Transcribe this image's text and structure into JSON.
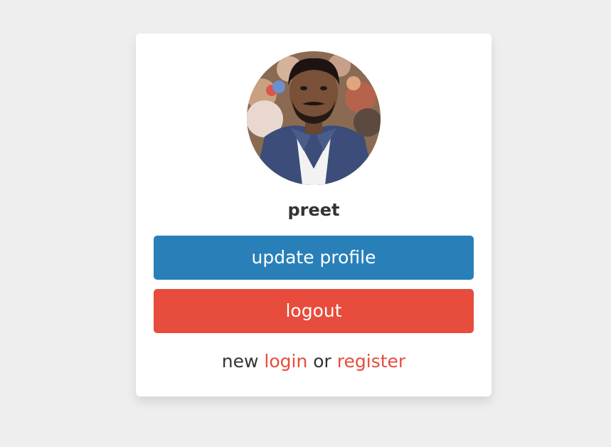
{
  "profile": {
    "username": "preet",
    "avatar_icon": "user-photo"
  },
  "buttons": {
    "update_label": "update profile",
    "logout_label": "logout"
  },
  "footer": {
    "prefix": "new",
    "login_label": "login",
    "separator": "or",
    "register_label": "register"
  },
  "colors": {
    "background": "#eeeeee",
    "card": "#ffffff",
    "update_button": "#2980b9",
    "logout_button": "#e74c3c",
    "link": "#e74c3c",
    "text": "#333333"
  }
}
